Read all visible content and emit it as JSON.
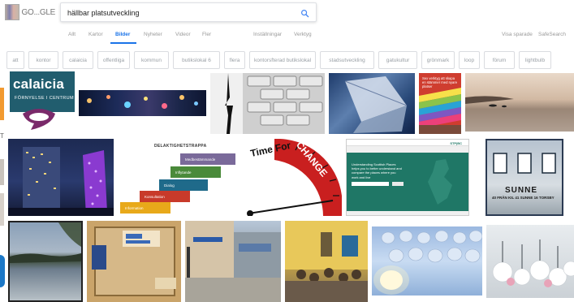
{
  "logo": {
    "text": "GO...GLE"
  },
  "search": {
    "query": "hällbar platsutveckling"
  },
  "tabs": [
    {
      "label": "Allt"
    },
    {
      "label": "Kartor"
    },
    {
      "label": "Bilder"
    },
    {
      "label": "Nyheter"
    },
    {
      "label": "Videor"
    },
    {
      "label": "Fler"
    },
    {
      "label": "Inställningar"
    },
    {
      "label": "Verktyg"
    }
  ],
  "tabs_right": {
    "saved": "Visa sparade",
    "safesearch": "SafeSearch"
  },
  "chips": [
    "att",
    "kontor",
    "calaicia",
    "offentliga",
    "kommun",
    "butikslokal 6",
    "flera",
    "kontorsfterad butikslokal",
    "stadsutveckling",
    "gatukultur",
    "grönmark",
    "loop",
    "förum",
    "lightbulb"
  ],
  "left_strip": {
    "letter": "T"
  },
  "images": {
    "calaicia": {
      "title": "calaicia",
      "subtitle": "FÖRNYELSE I CENTRUM"
    },
    "book": {
      "title": "Sex verktyg att skapa en stämmer med nyare platser"
    },
    "ladder": {
      "title": "DELAKTIGHETSTRAPPA",
      "steps": [
        "Medbestämmande",
        "Inflytande",
        "Dialog",
        "Konsultation",
        "Information"
      ]
    },
    "clock": {
      "time_for": "Time For",
      "change": "CHANGE"
    },
    "website": {
      "brand": "STP|BC",
      "heading": "Understanding Scottish Places helps you to better understand and compare the places where you work and live"
    },
    "sunne": {
      "sign": "SUNNE",
      "sign2": "40 FRÅN KIL 41 SUNNE 16 TORSBY"
    }
  },
  "colors": {
    "accent": "#1a73e8",
    "calaicia": "#215d6e",
    "website_green": "#1f7766"
  }
}
